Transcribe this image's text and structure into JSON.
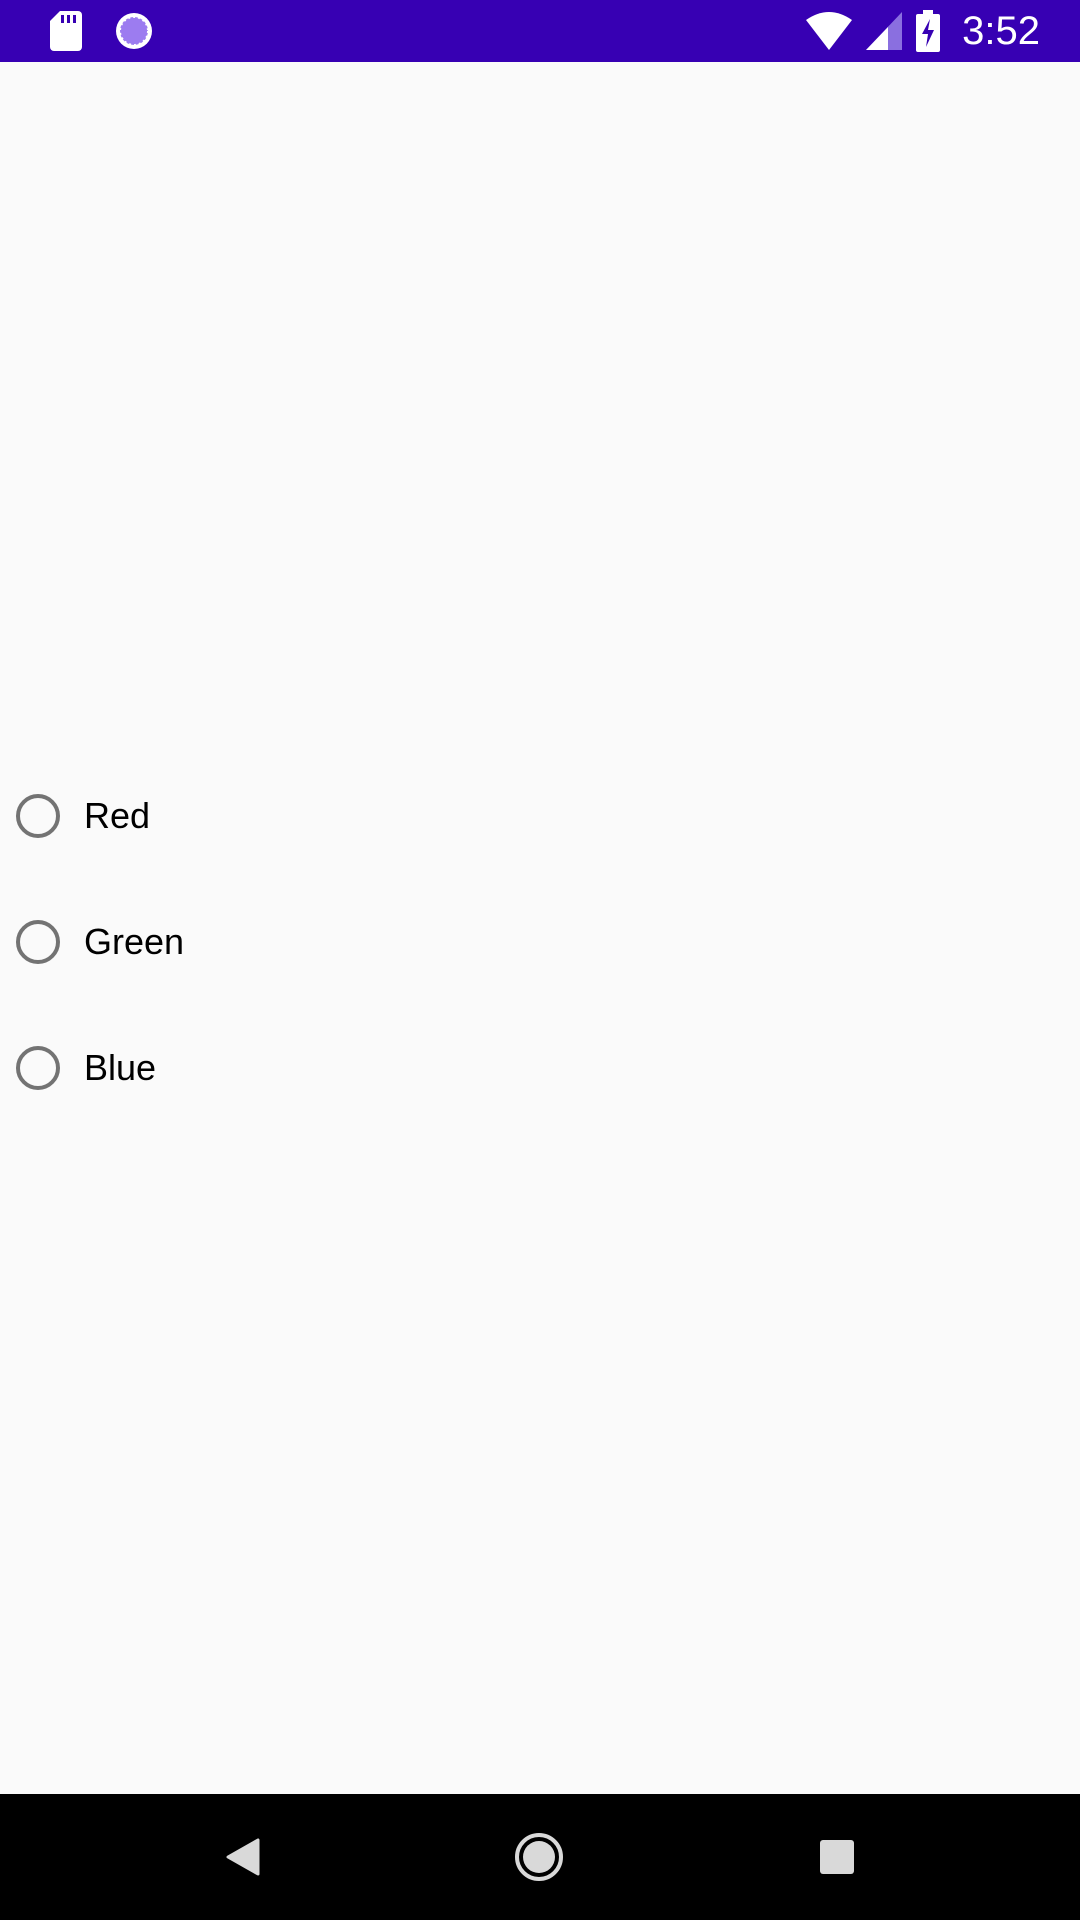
{
  "status_bar": {
    "time": "3:52",
    "background_color": "#3700b3",
    "left_icons": [
      "sd-card-icon",
      "sync-icon"
    ],
    "right_icons": [
      "wifi-icon",
      "cell-signal-icon",
      "battery-charging-icon"
    ]
  },
  "radio_group": {
    "options": [
      {
        "label": "Red",
        "checked": false
      },
      {
        "label": "Green",
        "checked": false
      },
      {
        "label": "Blue",
        "checked": false
      }
    ]
  },
  "nav_bar": {
    "buttons": [
      "back-icon",
      "home-icon",
      "recents-icon"
    ],
    "background_color": "#000000"
  },
  "colors": {
    "page_background": "#fafafa",
    "radio_outline": "#737373",
    "text": "#000000"
  }
}
